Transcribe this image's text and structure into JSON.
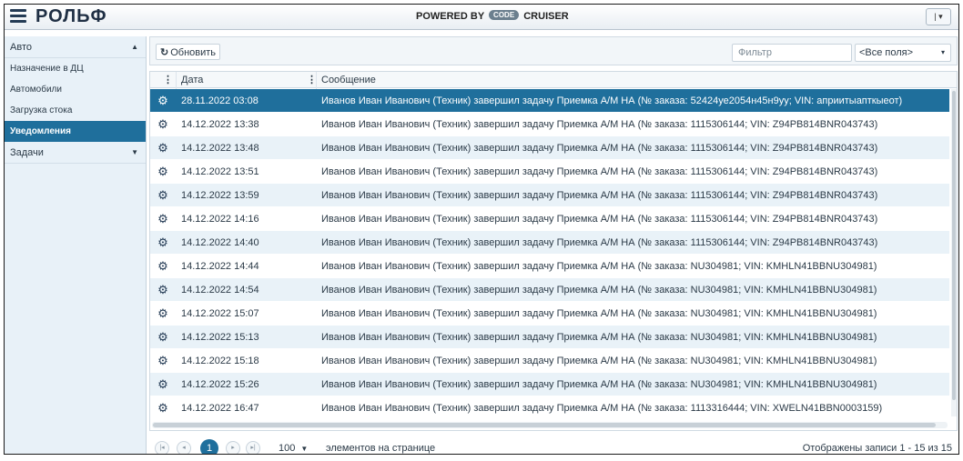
{
  "app": {
    "logo": "РОЛЬФ",
    "powered_prefix": "POWERED BY",
    "powered_badge": "CODE",
    "powered_suffix": "CRUISER",
    "user_button": "| ▾",
    "menu_icon": "hamburger-icon"
  },
  "sidebar": {
    "group_auto": "Авто",
    "group_auto_arrow": "▲",
    "items": [
      {
        "label": "Назначение в ДЦ",
        "active": false
      },
      {
        "label": "Автомобили",
        "active": false
      },
      {
        "label": "Загрузка стока",
        "active": false
      },
      {
        "label": "Уведомления",
        "active": true
      }
    ],
    "group_tasks": "Задачи",
    "group_tasks_arrow": "▼"
  },
  "toolbar": {
    "refresh_label": "Обновить",
    "refresh_icon": "refresh-icon",
    "filter_placeholder": "Фильтр",
    "field_select_value": "<Все поля>",
    "field_select_caret": "▾"
  },
  "grid": {
    "columns": {
      "menu": "⋮",
      "date": "Дата",
      "message": "Сообщение"
    },
    "row_icon": "gear-icon",
    "rows": [
      {
        "date": "28.11.2022 03:08",
        "message": "Иванов Иван Иванович (Техник) завершил задачу Приемка А/М НА (№ заказа: 52424уе2054н45н9уу; VIN: априитыапткыеот)",
        "selected": true
      },
      {
        "date": "14.12.2022 13:38",
        "message": "Иванов Иван Иванович (Техник) завершил задачу Приемка А/М НА (№ заказа: 1115306144; VIN: Z94PB814BNR043743)",
        "selected": false
      },
      {
        "date": "14.12.2022 13:48",
        "message": "Иванов Иван Иванович (Техник) завершил задачу Приемка А/М НА (№ заказа: 1115306144; VIN: Z94PB814BNR043743)",
        "selected": false
      },
      {
        "date": "14.12.2022 13:51",
        "message": "Иванов Иван Иванович (Техник) завершил задачу Приемка А/М НА (№ заказа: 1115306144; VIN: Z94PB814BNR043743)",
        "selected": false
      },
      {
        "date": "14.12.2022 13:59",
        "message": "Иванов Иван Иванович (Техник) завершил задачу Приемка А/М НА (№ заказа: 1115306144; VIN: Z94PB814BNR043743)",
        "selected": false
      },
      {
        "date": "14.12.2022 14:16",
        "message": "Иванов Иван Иванович (Техник) завершил задачу Приемка А/М НА (№ заказа: 1115306144; VIN: Z94PB814BNR043743)",
        "selected": false
      },
      {
        "date": "14.12.2022 14:40",
        "message": "Иванов Иван Иванович (Техник) завершил задачу Приемка А/М НА (№ заказа: 1115306144; VIN: Z94PB814BNR043743)",
        "selected": false
      },
      {
        "date": "14.12.2022 14:44",
        "message": "Иванов Иван Иванович (Техник) завершил задачу Приемка А/М НА (№ заказа: NU304981; VIN: KMHLN41BBNU304981)",
        "selected": false
      },
      {
        "date": "14.12.2022 14:54",
        "message": "Иванов Иван Иванович (Техник) завершил задачу Приемка А/М НА (№ заказа: NU304981; VIN: KMHLN41BBNU304981)",
        "selected": false
      },
      {
        "date": "14.12.2022 15:07",
        "message": "Иванов Иван Иванович (Техник) завершил задачу Приемка А/М НА (№ заказа: NU304981; VIN: KMHLN41BBNU304981)",
        "selected": false
      },
      {
        "date": "14.12.2022 15:13",
        "message": "Иванов Иван Иванович (Техник) завершил задачу Приемка А/М НА (№ заказа: NU304981; VIN: KMHLN41BBNU304981)",
        "selected": false
      },
      {
        "date": "14.12.2022 15:18",
        "message": "Иванов Иван Иванович (Техник) завершил задачу Приемка А/М НА (№ заказа: NU304981; VIN: KMHLN41BBNU304981)",
        "selected": false
      },
      {
        "date": "14.12.2022 15:26",
        "message": "Иванов Иван Иванович (Техник) завершил задачу Приемка А/М НА (№ заказа: NU304981; VIN: KMHLN41BBNU304981)",
        "selected": false
      },
      {
        "date": "14.12.2022 16:47",
        "message": "Иванов Иван Иванович (Техник) завершил задачу Приемка А/М НА (№ заказа: 1113316444; VIN: XWELN41BBN0003159)",
        "selected": false
      }
    ]
  },
  "pager": {
    "first": "|◂",
    "prev": "◂",
    "current": "1",
    "next": "▸",
    "last": "▸|",
    "page_size": "100",
    "page_size_caret": "▼",
    "per_page_label": "элементов на странице",
    "info": "Отображены записи 1 - 15 из 15"
  }
}
